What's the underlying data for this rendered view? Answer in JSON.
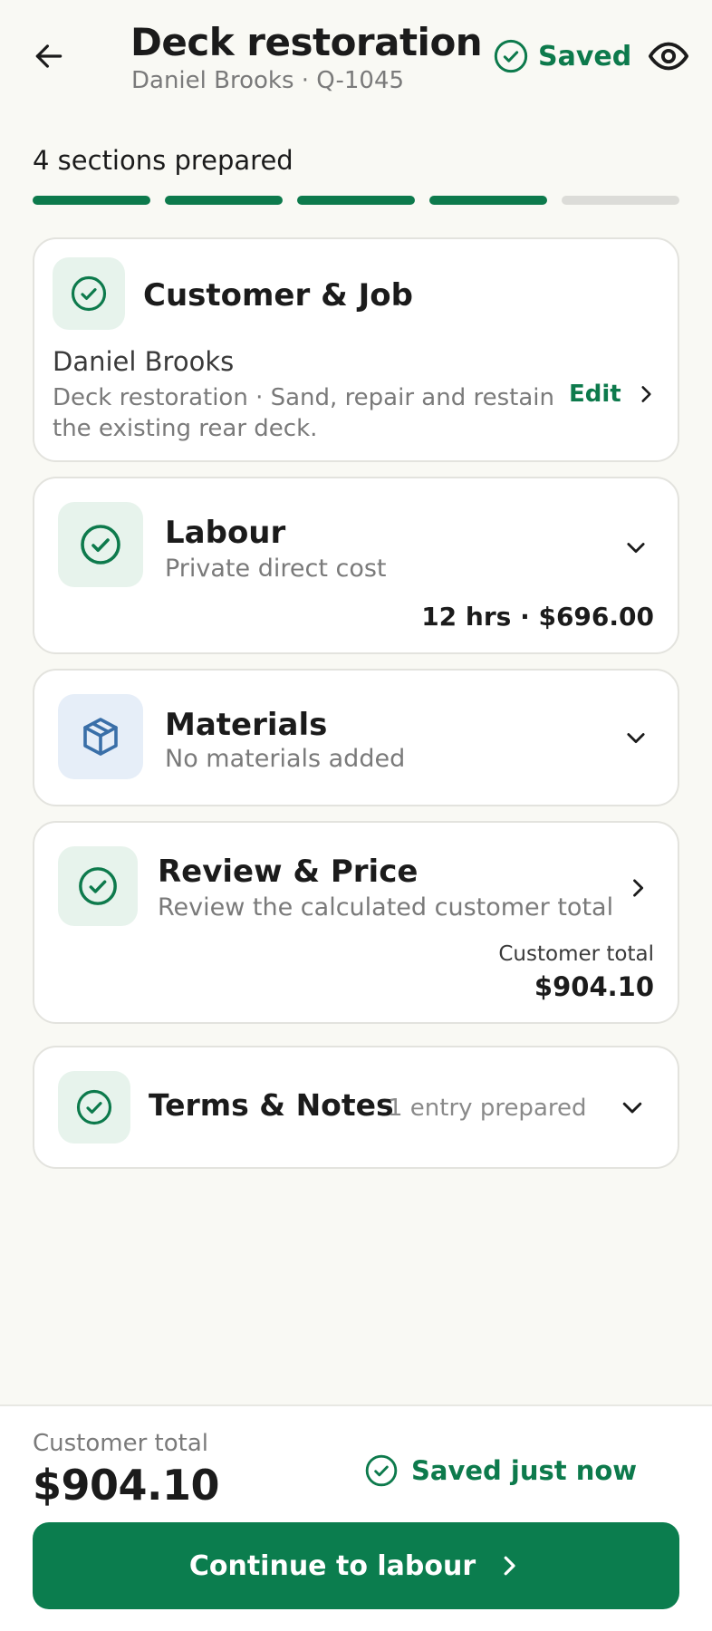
{
  "header": {
    "title": "Deck restoration",
    "subtitle": "Daniel Brooks · Q-1045",
    "saved_label": "Saved"
  },
  "progress": {
    "label": "4 sections prepared",
    "completed": 4,
    "total": 5
  },
  "sections": {
    "customer": {
      "title": "Customer & Job",
      "name": "Daniel Brooks",
      "description": "Deck restoration · Sand, repair and restain the existing rear deck.",
      "edit_label": "Edit"
    },
    "labour": {
      "title": "Labour",
      "subtitle": "Private direct cost",
      "summary": "12 hrs · $696.00"
    },
    "materials": {
      "title": "Materials",
      "subtitle": "No materials added"
    },
    "review": {
      "title": "Review & Price",
      "subtitle": "Review the calculated customer total",
      "total_label": "Customer total",
      "total_value": "$904.10"
    },
    "terms": {
      "title": "Terms & Notes",
      "count": "1 entry prepared"
    }
  },
  "footer": {
    "total_label": "Customer total",
    "total_value": "$904.10",
    "saved_status": "Saved just now",
    "cta_label": "Continue to labour"
  },
  "colors": {
    "accent": "#0d7a4c",
    "background": "#f9f9f4",
    "card": "#ffffff",
    "icon_bg_green": "#e7f3ec",
    "icon_bg_blue": "#e6eef8",
    "icon_blue": "#3a6fa8",
    "muted_text": "#7a7a7a",
    "progress_incomplete": "#dcdcd8"
  },
  "icons": [
    "back-arrow-icon",
    "check-circle-icon",
    "eye-icon",
    "chevron-right-icon",
    "chevron-down-icon",
    "box-icon"
  ]
}
